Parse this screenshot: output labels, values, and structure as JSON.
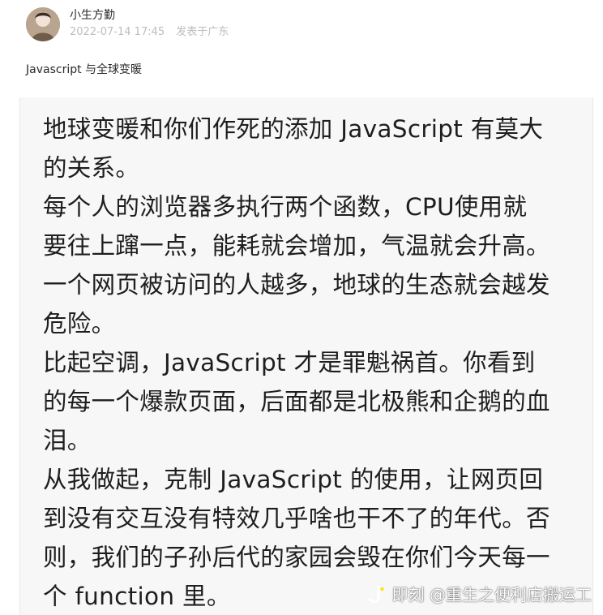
{
  "author": {
    "name": "小生方勤",
    "avatar_icon": "avatar-photo",
    "timestamp": "2022-07-14 17:45",
    "location": "发表于广东"
  },
  "post": {
    "title": "Javascript 与全球变暖",
    "body_lines": [
      "地球变暖和你们作死的添加 JavaScript 有莫大",
      "的关系。",
      "每个人的浏览器多执行两个函数，CPU使用就",
      "要往上蹿一点，能耗就会增加，气温就会升高。",
      "一个网页被访问的人越多，地球的生态就会越发",
      "危险。",
      "比起空调，JavaScript 才是罪魁祸首。你看到",
      "的每一个爆款页面，后面都是北极熊和企鹅的血",
      "泪。",
      "从我做起，克制 JavaScript 的使用，让网页回",
      "到没有交互没有特效几乎啥也干不了的年代。否",
      "则，我们的子孙后代的家园会毁在你们今天每一",
      "个 function 里。"
    ]
  },
  "watermark": {
    "logo_icon": "jike-logo-icon",
    "text": "即刻 @重生之便利店搬运工"
  }
}
